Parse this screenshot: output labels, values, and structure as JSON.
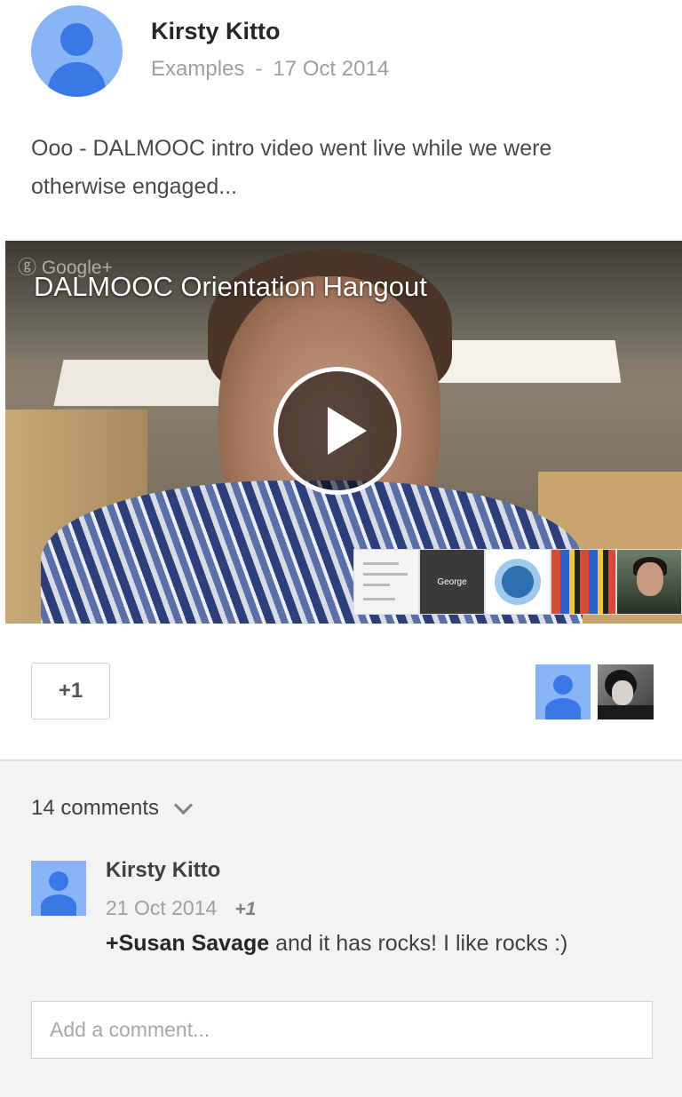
{
  "post": {
    "author": "Kirsty Kitto",
    "community": "Examples",
    "separator": "-",
    "date": "17 Oct 2014",
    "text": "Ooo - DALMOOC intro video went live while we were otherwise engaged...",
    "avatar_icon": "person-placeholder-icon"
  },
  "video": {
    "source_mark": "Google+",
    "title": "DALMOOC Orientation Hangout",
    "play_icon": "play-icon",
    "thumbnail_label": "George"
  },
  "actions": {
    "plus_one_label": "+1",
    "sharers": [
      "person-placeholder-icon",
      "profile-photo"
    ]
  },
  "comments": {
    "count_label": "14 comments",
    "toggle_icon": "chevron-down-icon",
    "items": [
      {
        "author": "Kirsty Kitto",
        "date": "21 Oct 2014",
        "plus": "+1",
        "mention": "+Susan Savage",
        "text": " and it has rocks! I like rocks :)"
      }
    ],
    "input_placeholder": "Add a comment..."
  },
  "colors": {
    "avatar_light": "#8ab4f8",
    "avatar_dark": "#3b78e7",
    "comments_bg": "#f3f3f3"
  }
}
